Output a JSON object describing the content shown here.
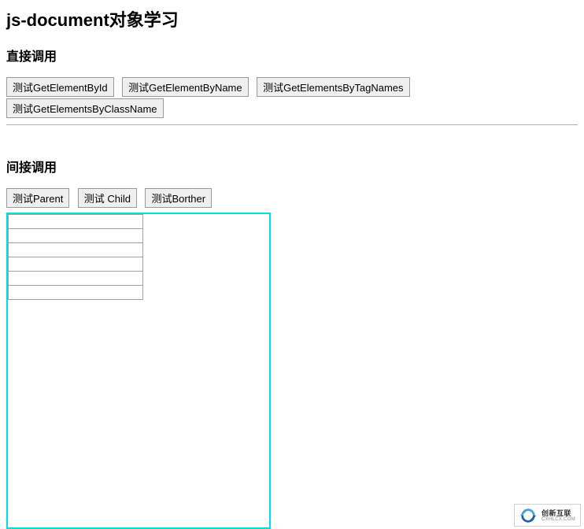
{
  "title": "js-document对象学习",
  "section1": {
    "heading": "直接调用",
    "buttons": {
      "b1": "测试GetElementById",
      "b2": "测试GetElementByName",
      "b3": "测试GetElementsByTagNames",
      "b4": "测试GetElementsByClassName"
    }
  },
  "section2": {
    "heading": "间接调用",
    "buttons": {
      "b1": "测试Parent",
      "b2": "测试 Child",
      "b3": "测试Borther"
    },
    "table": {
      "rows": 6,
      "cols": 1,
      "cells": [
        "",
        "",
        "",
        "",
        "",
        ""
      ]
    }
  },
  "watermark": {
    "line1": "创新互联",
    "line2": "CXHLCX.COM"
  },
  "colors": {
    "cyan_border": "#00e0e0",
    "button_bg": "#efefef",
    "button_border": "#9a9a9a",
    "table_border": "#a0a0a0"
  }
}
